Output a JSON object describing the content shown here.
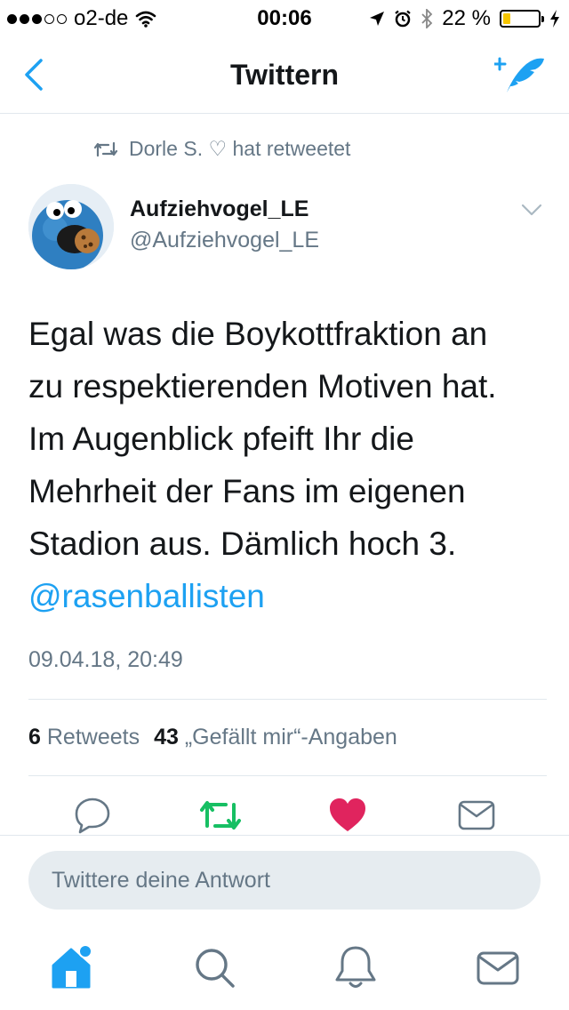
{
  "status": {
    "carrier": "o2-de",
    "time": "00:06",
    "battery": "22 %",
    "battery_level": 0.22,
    "signal_bars": 3,
    "signal_max": 5
  },
  "nav": {
    "title": "Twittern"
  },
  "retweet_context": "Dorle S. ♡ hat retweetet",
  "author": {
    "name": "Aufziehvogel_LE",
    "handle": "@Aufziehvogel_LE"
  },
  "tweet": {
    "lines": [
      "Egal was die Boykottfraktion an",
      "zu respektierenden Motiven hat.",
      "Im Augenblick pfeift Ihr die",
      "Mehrheit der Fans im eigenen",
      "Stadion aus. Dämlich hoch 3."
    ],
    "mention": "@rasenballisten",
    "date": "09.04.18, 20:49"
  },
  "stats": {
    "retweets_count": "6",
    "retweets_label": "Retweets",
    "likes_count": "43",
    "likes_label": "„Gefällt mir“-Angaben"
  },
  "reply": {
    "placeholder": "Twittere deine Antwort"
  },
  "colors": {
    "accent": "#1da1f2",
    "retweet_green": "#17bf63",
    "like_red": "#e0245e",
    "secondary_text": "#657786"
  },
  "icons": {
    "back": "chevron-left-icon",
    "compose": "compose-tweet-icon",
    "retweet_context": "retweet-icon",
    "caret": "chevron-down-icon",
    "reply": "reply-icon",
    "retweet": "retweet-icon",
    "like": "heart-icon",
    "dm": "envelope-icon",
    "tab_home": "home-icon",
    "tab_search": "search-icon",
    "tab_notifications": "bell-icon",
    "tab_messages": "envelope-icon"
  }
}
